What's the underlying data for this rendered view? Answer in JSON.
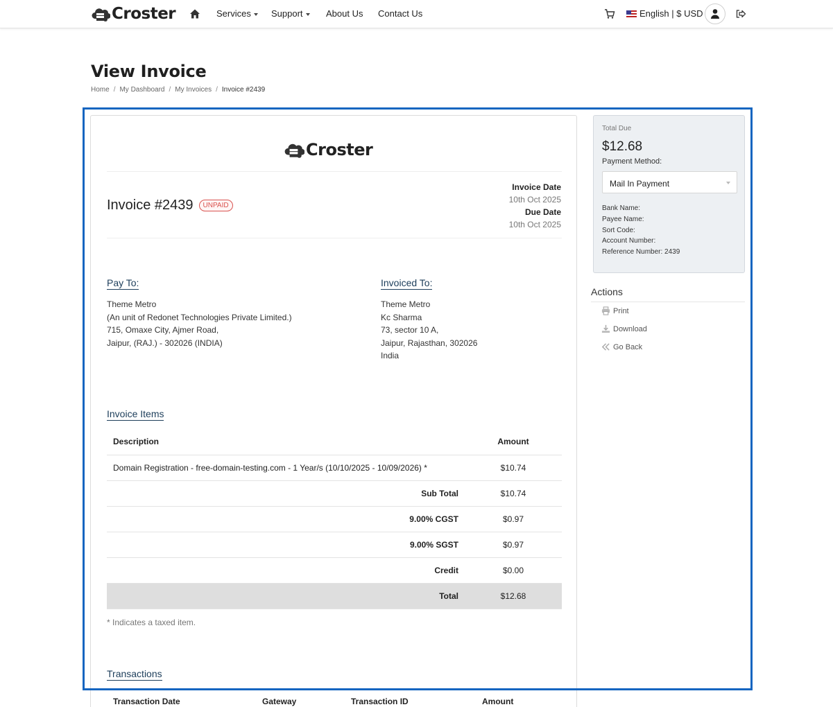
{
  "nav": {
    "brand": "Croster",
    "items": [
      {
        "label": "Services",
        "dropdown": true
      },
      {
        "label": "Support",
        "dropdown": true
      },
      {
        "label": "About Us",
        "dropdown": false
      },
      {
        "label": "Contact Us",
        "dropdown": false
      }
    ],
    "language_currency": "English | $ USD",
    "icons": [
      "home-icon",
      "cart-icon",
      "us-flag-icon",
      "user-icon",
      "logout-icon"
    ]
  },
  "page": {
    "title": "View Invoice",
    "breadcrumb": [
      "Home",
      "My Dashboard",
      "My Invoices",
      "Invoice #2439"
    ]
  },
  "invoice": {
    "brand": "Croster",
    "number": "Invoice #2439",
    "status": "UNPAID",
    "invoice_date_label": "Invoice Date",
    "invoice_date": "10th Oct 2025",
    "due_date_label": "Due Date",
    "due_date": "10th Oct 2025",
    "pay_to": {
      "heading": "Pay To:",
      "lines": [
        "Theme Metro",
        "(An unit of Redonet Technologies Private Limited.)",
        "715, Omaxe City, Ajmer Road,",
        "Jaipur, (RAJ.) - 302026 (INDIA)"
      ]
    },
    "invoiced_to": {
      "heading": "Invoiced To:",
      "lines": [
        "Theme Metro",
        "Kc Sharma",
        "73, sector 10 A,",
        "Jaipur, Rajasthan, 302026",
        "India"
      ]
    },
    "items_heading": "Invoice Items",
    "items_columns": [
      "Description",
      "Amount"
    ],
    "items": [
      {
        "description": "Domain Registration - free-domain-testing.com - 1 Year/s (10/10/2025 - 10/09/2026) *",
        "amount": "$10.74"
      }
    ],
    "summary": [
      {
        "label": "Sub Total",
        "amount": "$10.74"
      },
      {
        "label": "9.00% CGST",
        "amount": "$0.97"
      },
      {
        "label": "9.00% SGST",
        "amount": "$0.97"
      },
      {
        "label": "Credit",
        "amount": "$0.00"
      },
      {
        "label": "Total",
        "amount": "$12.68"
      }
    ],
    "taxed_note": "* Indicates a taxed item.",
    "transactions_heading": "Transactions",
    "transactions_columns": [
      "Transaction Date",
      "Gateway",
      "Transaction ID",
      "Amount"
    ]
  },
  "sidebar": {
    "total_due_label": "Total Due",
    "total_due": "$12.68",
    "payment_method_label": "Payment Method:",
    "payment_method": "Mail In Payment",
    "bank_lines": [
      "Bank Name:",
      "Payee Name:",
      "Sort Code:",
      "Account Number:",
      "Reference Number: 2439"
    ],
    "actions_title": "Actions",
    "actions": [
      {
        "label": "Print",
        "icon": "print-icon"
      },
      {
        "label": "Download",
        "icon": "download-icon"
      },
      {
        "label": "Go Back",
        "icon": "double-chevron-left-icon"
      }
    ]
  },
  "colors": {
    "highlight_frame": "#1565c0",
    "unpaid": "#d9534f",
    "section_heading": "#1c3d5a",
    "total_row": "#dedede",
    "due_panel": "#edf0f3"
  }
}
